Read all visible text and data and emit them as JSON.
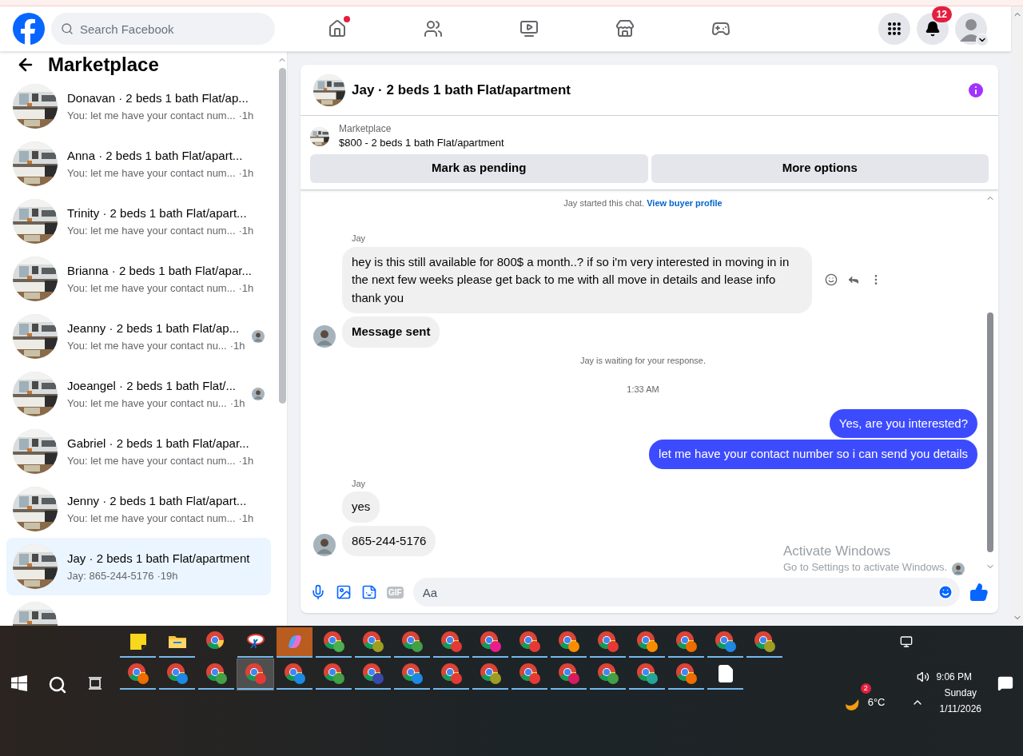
{
  "header": {
    "search": {
      "placeholder": "Search Facebook"
    },
    "nav": [
      {
        "kind": "home",
        "dot": true
      },
      {
        "kind": "friends",
        "dot": false
      },
      {
        "kind": "video",
        "dot": false
      },
      {
        "kind": "marketplace",
        "dot": false
      },
      {
        "kind": "gaming",
        "dot": false
      }
    ],
    "notifications": {
      "count": "12"
    }
  },
  "sidebar": {
    "title": "Marketplace",
    "items": [
      {
        "title": "Donavan · 2 beds 1 bath Flat/ap...",
        "preview": "You: let me have your contact num...",
        "time": "·1h",
        "seen": false,
        "selected": false
      },
      {
        "title": "Anna · 2 beds 1 bath Flat/apart...",
        "preview": "You: let me have your contact num...",
        "time": "·1h",
        "seen": false,
        "selected": false
      },
      {
        "title": "Trinity · 2 beds 1 bath Flat/apart...",
        "preview": "You: let me have your contact num...",
        "time": "·1h",
        "seen": false,
        "selected": false
      },
      {
        "title": "Brianna · 2 beds 1 bath Flat/apar...",
        "preview": "You: let me have your contact num...",
        "time": "·1h",
        "seen": false,
        "selected": false
      },
      {
        "title": "Jeanny · 2 beds 1 bath Flat/ap...",
        "preview": "You: let me have your contact nu...",
        "time": "·1h",
        "seen": true,
        "selected": false
      },
      {
        "title": "Joeangel · 2 beds 1 bath Flat/...",
        "preview": "You: let me have your contact nu...",
        "time": "·1h",
        "seen": true,
        "selected": false
      },
      {
        "title": "Gabriel · 2 beds 1 bath Flat/apar...",
        "preview": "You: let me have your contact num...",
        "time": "·1h",
        "seen": false,
        "selected": false
      },
      {
        "title": "Jenny · 2 beds 1 bath Flat/apart...",
        "preview": "You: let me have your contact num...",
        "time": "·1h",
        "seen": false,
        "selected": false
      },
      {
        "title": "Jay · 2 beds 1 bath Flat/apartment",
        "preview": "Jay: 865-244-5176",
        "time": "·19h",
        "seen": false,
        "selected": true
      }
    ]
  },
  "chat": {
    "title": "Jay · 2 beds 1 bath Flat/apartment",
    "listing": {
      "label": "Marketplace",
      "name": "$800 - 2 beds 1 bath Flat/apartment",
      "buttons": [
        "Mark as pending",
        "More options"
      ]
    },
    "messages": [
      {
        "kind": "system",
        "text": "Jay started this chat.",
        "link": "View buyer profile"
      },
      {
        "kind": "sender",
        "text": "Jay"
      },
      {
        "kind": "incoming",
        "text": "hey is this still available for 800$ a month..? if so i'm very interested in moving in in the next few weeks please get back to me with all move in details and lease info thank you",
        "avatar": false,
        "bold": false,
        "actions": true
      },
      {
        "kind": "incoming",
        "text": "Message sent",
        "avatar": true,
        "bold": true,
        "actions": false
      },
      {
        "kind": "system",
        "text": "Jay is waiting for your response."
      },
      {
        "kind": "time",
        "text": "1:33 AM"
      },
      {
        "kind": "outgoing",
        "text": "Yes, are you interested?"
      },
      {
        "kind": "outgoing",
        "text": "let me have your contact number so i can send you details"
      },
      {
        "kind": "sender",
        "text": "Jay"
      },
      {
        "kind": "incoming",
        "text": "yes",
        "avatar": false,
        "bold": false,
        "actions": false
      },
      {
        "kind": "incoming",
        "text": "865-244-5176",
        "avatar": true,
        "bold": false,
        "actions": false
      },
      {
        "kind": "seen"
      }
    ],
    "composer": {
      "gif": "GIF",
      "placeholder": "Aa"
    }
  },
  "activation": {
    "title": "Activate Windows",
    "text": "Go to Settings to activate Windows."
  },
  "taskbar": {
    "rows": [
      [
        {
          "kind": "notes",
          "running": true,
          "selected": false,
          "hovered": false
        },
        {
          "kind": "folder",
          "running": true,
          "selected": false,
          "hovered": false
        },
        {
          "kind": "browser",
          "running": false,
          "selected": false,
          "hovered": false
        },
        {
          "kind": "snip",
          "running": true,
          "selected": false,
          "hovered": false
        },
        {
          "kind": "copilot",
          "running": true,
          "selected": true,
          "hovered": false
        },
        {
          "kind": "profile",
          "color": "#4caf50",
          "running": true,
          "selected": false,
          "hovered": false
        },
        {
          "kind": "profile",
          "color": "#9e9d24",
          "running": true,
          "selected": false,
          "hovered": false
        },
        {
          "kind": "profile",
          "color": "#43a047",
          "running": true,
          "selected": false,
          "hovered": false
        },
        {
          "kind": "profile",
          "color": "#e53935",
          "running": true,
          "selected": false,
          "hovered": false
        },
        {
          "kind": "profile",
          "color": "#e91e8c",
          "running": true,
          "selected": false,
          "hovered": false
        },
        {
          "kind": "profile",
          "color": "#e53935",
          "running": true,
          "selected": false,
          "hovered": false
        },
        {
          "kind": "profile",
          "color": "#fb8c00",
          "running": true,
          "selected": false,
          "hovered": false
        },
        {
          "kind": "profile",
          "color": "#e53935",
          "running": true,
          "selected": false,
          "hovered": false
        },
        {
          "kind": "profile",
          "color": "#fb8c00",
          "running": true,
          "selected": false,
          "hovered": false
        },
        {
          "kind": "profile",
          "color": "#ef6c00",
          "running": true,
          "selected": false,
          "hovered": false
        },
        {
          "kind": "profile",
          "color": "#1e88e5",
          "running": true,
          "selected": false,
          "hovered": false
        },
        {
          "kind": "profile",
          "color": "#9e9d24",
          "running": true,
          "selected": false,
          "hovered": false
        }
      ],
      [
        {
          "kind": "profile",
          "color": "#ef6c00",
          "running": true,
          "selected": false,
          "hovered": false
        },
        {
          "kind": "profile",
          "color": "#1e88e5",
          "running": true,
          "selected": false,
          "hovered": false
        },
        {
          "kind": "profile",
          "color": "#43a047",
          "running": true,
          "selected": false,
          "hovered": false
        },
        {
          "kind": "profile",
          "color": "#e53935",
          "running": true,
          "selected": false,
          "hovered": true
        },
        {
          "kind": "profile",
          "color": "#1e88e5",
          "running": true,
          "selected": false,
          "hovered": false
        },
        {
          "kind": "profile",
          "color": "#43a047",
          "running": true,
          "selected": false,
          "hovered": false
        },
        {
          "kind": "profile",
          "color": "#3949ab",
          "running": true,
          "selected": false,
          "hovered": false
        },
        {
          "kind": "profile",
          "color": "#1e88e5",
          "running": true,
          "selected": false,
          "hovered": false
        },
        {
          "kind": "profile",
          "color": "#e53935",
          "running": true,
          "selected": false,
          "hovered": false
        },
        {
          "kind": "profile",
          "color": "#9e9d24",
          "running": true,
          "selected": false,
          "hovered": false
        },
        {
          "kind": "profile",
          "color": "#e53935",
          "running": true,
          "selected": false,
          "hovered": false
        },
        {
          "kind": "profile",
          "color": "#d81b60",
          "running": true,
          "selected": false,
          "hovered": false
        },
        {
          "kind": "profile",
          "color": "#43a047",
          "running": true,
          "selected": false,
          "hovered": false
        },
        {
          "kind": "profile",
          "color": "#26a69a",
          "running": true,
          "selected": false,
          "hovered": false
        },
        {
          "kind": "profile",
          "color": "#ef6c00",
          "running": true,
          "selected": false,
          "hovered": false
        },
        {
          "kind": "file",
          "running": true,
          "selected": false,
          "hovered": false
        }
      ]
    ],
    "weather": {
      "badge": "2",
      "temp": "6°C"
    },
    "clock": {
      "time": "9:06 PM",
      "day": "Sunday",
      "date": "1/11/2026"
    }
  }
}
